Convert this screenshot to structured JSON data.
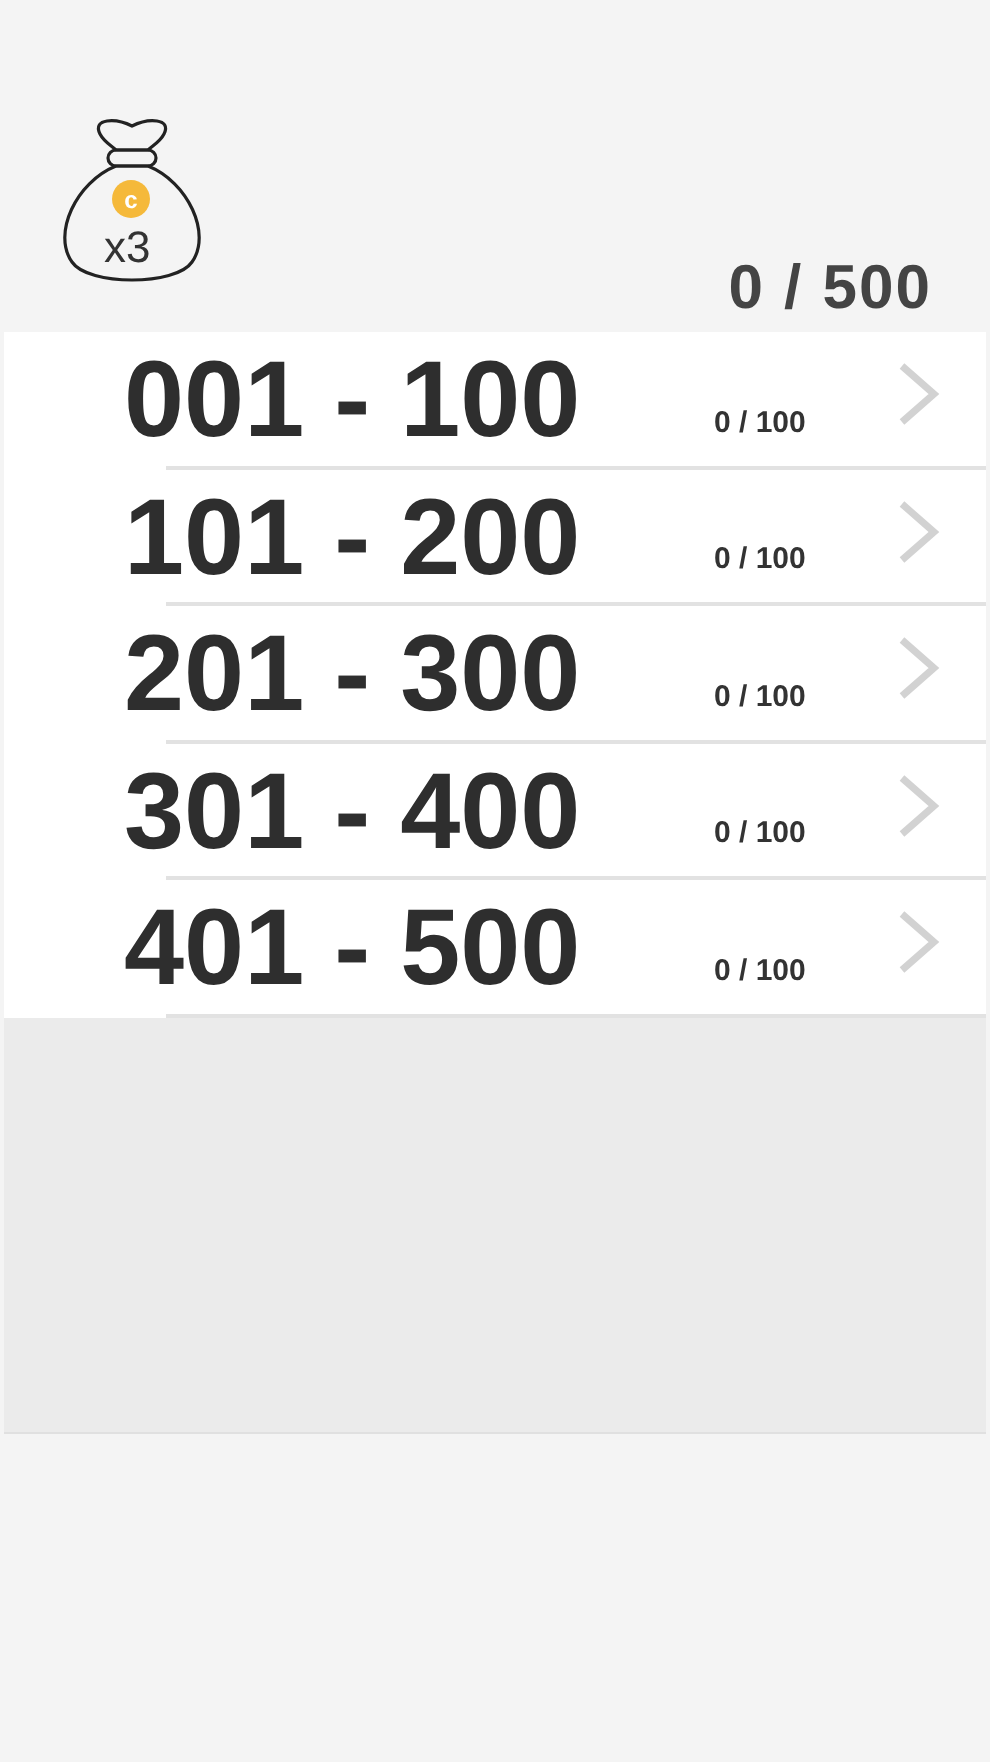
{
  "bag": {
    "coin_symbol": "c",
    "count": "x3"
  },
  "total_progress": "0 / 500",
  "ranges": [
    {
      "label": "001 - 100",
      "progress": "0 / 100"
    },
    {
      "label": "101 - 200",
      "progress": "0 / 100"
    },
    {
      "label": "201 - 300",
      "progress": "0 / 100"
    },
    {
      "label": "301 - 400",
      "progress": "0 / 100"
    },
    {
      "label": "401 - 500",
      "progress": "0 / 100"
    }
  ]
}
